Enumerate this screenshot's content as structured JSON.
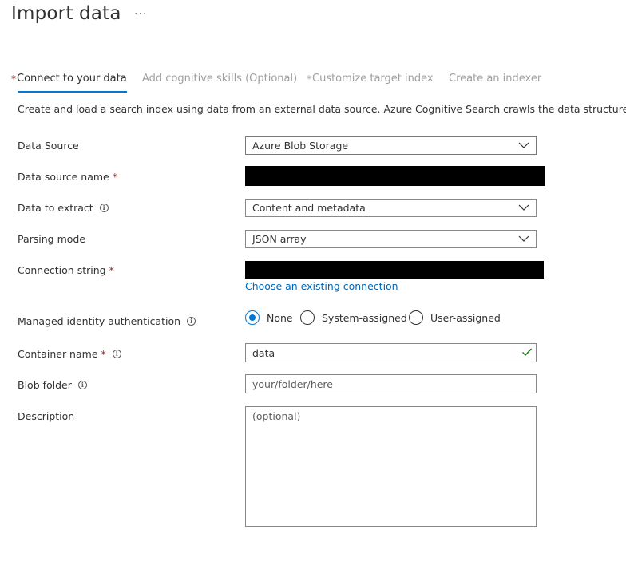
{
  "header": {
    "title": "Import data",
    "more_label": "···"
  },
  "tabs": [
    {
      "label": "Connect to your data",
      "required": true,
      "active": true
    },
    {
      "label": "Add cognitive skills (Optional)",
      "required": false,
      "active": false
    },
    {
      "label": "Customize target index",
      "required": true,
      "active": false
    },
    {
      "label": "Create an indexer",
      "required": false,
      "active": false
    }
  ],
  "required_marker": "*",
  "info_glyph": "i",
  "intro_text": "Create and load a search index using data from an external data source. Azure Cognitive Search crawls the data structure you prov",
  "form": {
    "data_source": {
      "label": "Data Source",
      "value": "Azure Blob Storage"
    },
    "data_source_name": {
      "label": "Data source name"
    },
    "data_to_extract": {
      "label": "Data to extract",
      "value": "Content and metadata"
    },
    "parsing_mode": {
      "label": "Parsing mode",
      "value": "JSON array"
    },
    "connection_string": {
      "label": "Connection string",
      "link": "Choose an existing connection"
    },
    "managed_identity": {
      "label": "Managed identity authentication",
      "options": [
        "None",
        "System-assigned",
        "User-assigned"
      ],
      "selected": "None"
    },
    "container_name": {
      "label": "Container name",
      "value": "data"
    },
    "blob_folder": {
      "label": "Blob folder",
      "placeholder": "your/folder/here"
    },
    "description": {
      "label": "Description",
      "placeholder": "(optional)"
    }
  },
  "colors": {
    "accent": "#0078d4",
    "required": "#a4262c",
    "link": "#0067b8",
    "focus_border": "#8764b8",
    "valid_check": "#107c10"
  }
}
